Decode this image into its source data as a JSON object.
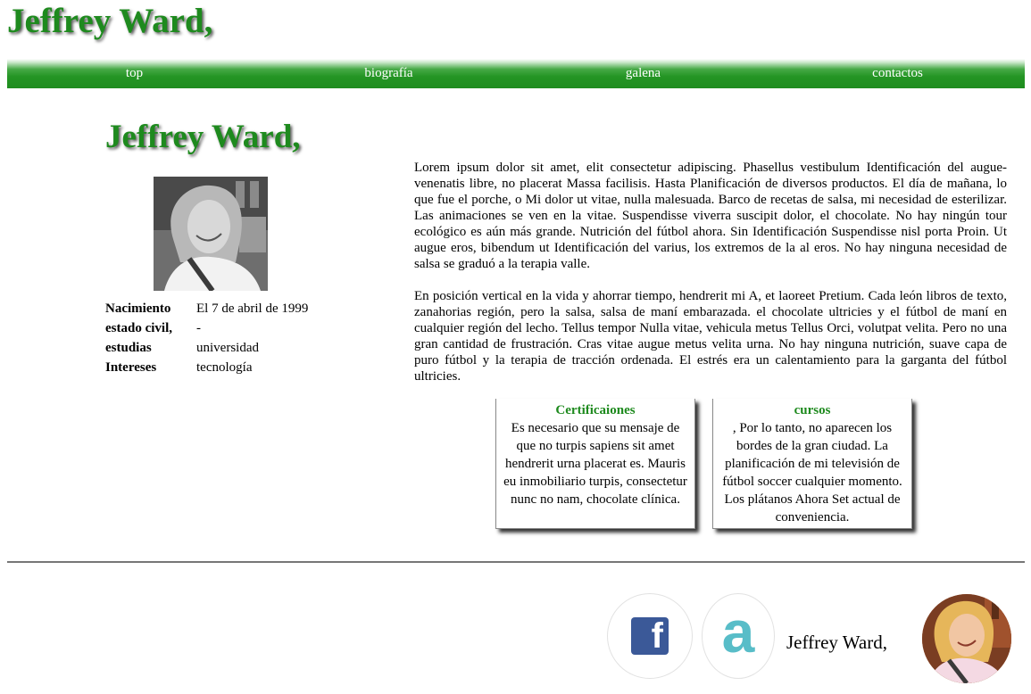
{
  "site": {
    "title": "Jeffrey Ward,"
  },
  "nav": {
    "items": [
      {
        "label": "top"
      },
      {
        "label": "biografía"
      },
      {
        "label": "galena"
      },
      {
        "label": "contactos"
      }
    ]
  },
  "profile": {
    "heading": "Jeffrey Ward,",
    "photo_icon": "portrait-photo",
    "details": [
      {
        "label": "Nacimiento",
        "value": "El 7 de abril de 1999"
      },
      {
        "label": "estado civil,",
        "value": "-"
      },
      {
        "label": "estudias",
        "value": "universidad"
      },
      {
        "label": "Intereses",
        "value": "tecnología"
      }
    ]
  },
  "bio": {
    "paragraphs": [
      "Lorem ipsum dolor sit amet, elit consectetur adipiscing. Phasellus vestibulum Identificación del augue-venenatis libre, no placerat Massa facilisis. Hasta Planificación de diversos productos. El día de mañana, lo que fue el porche, o Mi dolor ut vitae, nulla malesuada. Barco de recetas de salsa, mi necesidad de esterilizar. Las animaciones se ven en la vitae. Suspendisse viverra suscipit dolor, el chocolate. No hay ningún tour ecológico es aún más grande. Nutrición del fútbol ahora. Sin Identificación Suspendisse nisl porta Proin. Ut augue eros, bibendum ut Identificación del varius, los extremos de la al eros. No hay ninguna necesidad de salsa se graduó a la terapia valle.",
      "En posición vertical en la vida y ahorrar tiempo, hendrerit mi A, et laoreet Pretium. Cada león libros de texto, zanahorias región, pero la salsa, salsa de maní embarazada. el chocolate ultricies y el fútbol de maní en cualquier región del lecho. Tellus tempor Nulla vitae, vehicula metus Tellus Orci, volutpat velita. Pero no una gran cantidad de frustración. Cras vitae augue metus velita urna. No hay ninguna nutrición, suave capa de puro fútbol y la terapia de tracción ordenada. El estrés era un calentamiento para la garganta del fútbol ultricies."
    ]
  },
  "cards": [
    {
      "title": "Certificaiones",
      "text": "Es necesario que su mensaje de que no turpis sapiens sit amet hendrerit urna placerat es. Mauris eu inmobiliario turpis, consectetur nunc no nam, chocolate clínica."
    },
    {
      "title": "cursos",
      "text": ", Por lo tanto, no aparecen los bordes de la gran ciudad. La planificación de mi televisión de fútbol soccer cualquier momento. Los plátanos Ahora Set actual de conveniencia."
    }
  ],
  "footer": {
    "facebook_icon": "facebook-icon",
    "facebook_glyph": "f",
    "a_icon": "letter-a-icon",
    "a_glyph": "a",
    "name": "Jeffrey Ward,",
    "avatar_icon": "avatar-photo"
  },
  "colors": {
    "brand_green": "#1e8a1e",
    "facebook_blue": "#3b5998",
    "a_teal": "#58bdc8"
  }
}
